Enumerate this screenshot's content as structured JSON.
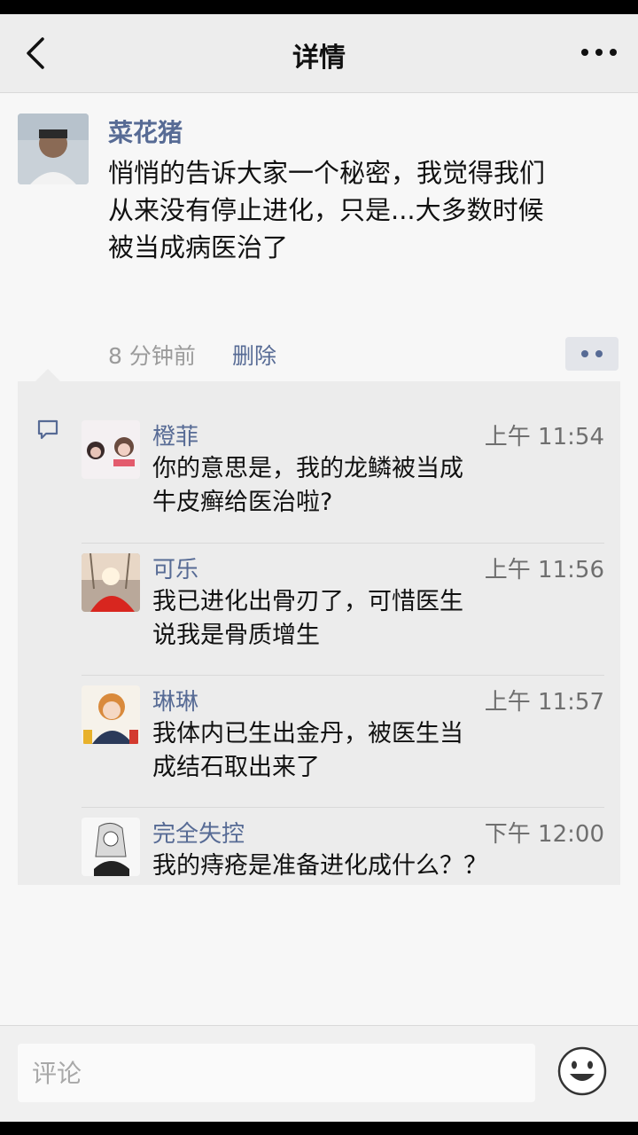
{
  "nav": {
    "title": "详情",
    "back_icon": "chevron-left-icon",
    "more_icon": "more-dots-icon"
  },
  "post": {
    "author": "菜花猪",
    "text_lines": [
      "悄悄的告诉大家一个秘密，我觉得我们",
      "从来没有停止进化，只是...大多数时候",
      "被当成病医治了"
    ],
    "time": "8 分钟前",
    "delete_label": "删除",
    "action_icon": "two-dots-icon"
  },
  "comments": [
    {
      "name": "橙菲",
      "time": "上午 11:54",
      "text_lines": [
        "你的意思是，我的龙鳞被当成",
        "牛皮癣给医治啦?"
      ]
    },
    {
      "name": "可乐",
      "time": "上午 11:56",
      "text_lines": [
        "我已进化出骨刃了，可惜医生",
        "说我是骨质增生"
      ]
    },
    {
      "name": "琳琳",
      "time": "上午 11:57",
      "text_lines": [
        "我体内已生出金丹，被医生当",
        "成结石取出来了"
      ]
    },
    {
      "name": "完全失控",
      "time": "下午 12:00",
      "text_lines": [
        "我的痔疮是准备进化成什么？？"
      ]
    }
  ],
  "input": {
    "placeholder": "评论",
    "emoji_icon": "smiley-icon"
  },
  "colors": {
    "link": "#576b95",
    "nav_bg": "#ededed",
    "panel_bg": "#ececec"
  }
}
